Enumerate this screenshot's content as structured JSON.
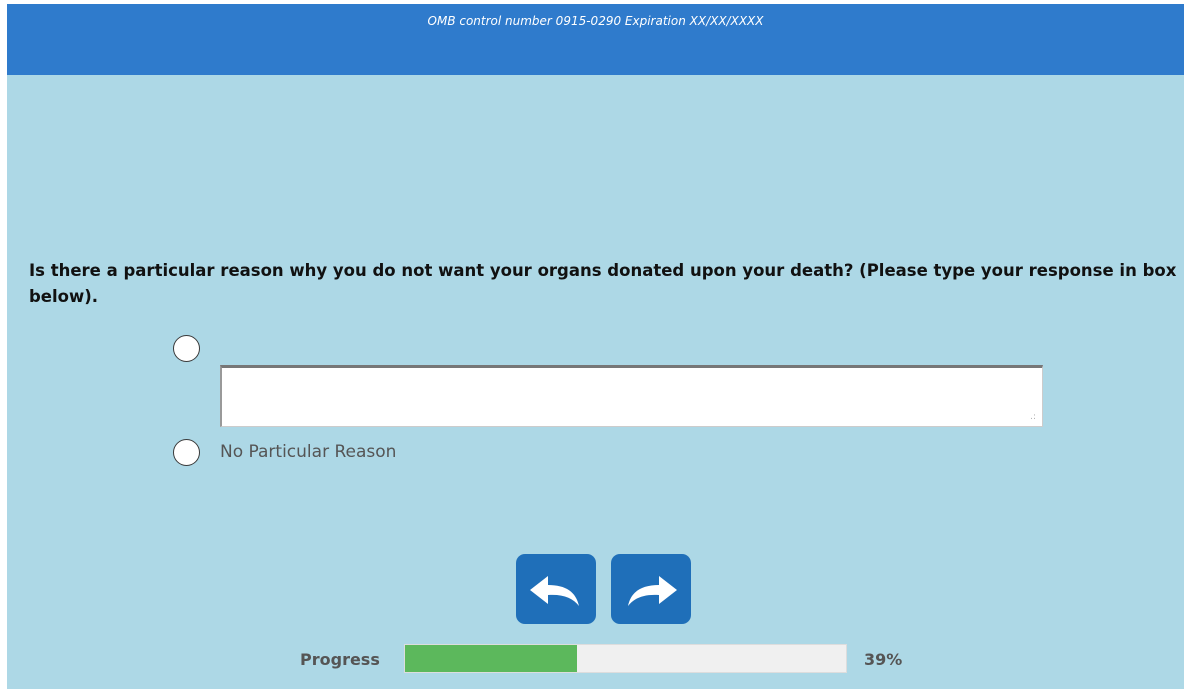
{
  "header": {
    "omb_text": "OMB control number 0915-0290 Expiration XX/XX/XXXX"
  },
  "question": {
    "text": "Is there a particular reason why you do not want your organs donated upon your death? (Please type your response in box below).",
    "options": [
      {
        "label": "",
        "type": "other-text",
        "selected": false,
        "text_value": ""
      },
      {
        "label": "No Particular Reason",
        "type": "radio",
        "selected": false
      }
    ]
  },
  "navigation": {
    "back_icon": "back-arrow-icon",
    "next_icon": "forward-arrow-icon"
  },
  "progress": {
    "label": "Progress",
    "value_text": "39%",
    "fraction": 0.39
  },
  "colors": {
    "header": "#2f7bcc",
    "background": "#add8e6",
    "nav_button": "#1f6fb9",
    "progress_fill": "#5cb85c"
  }
}
